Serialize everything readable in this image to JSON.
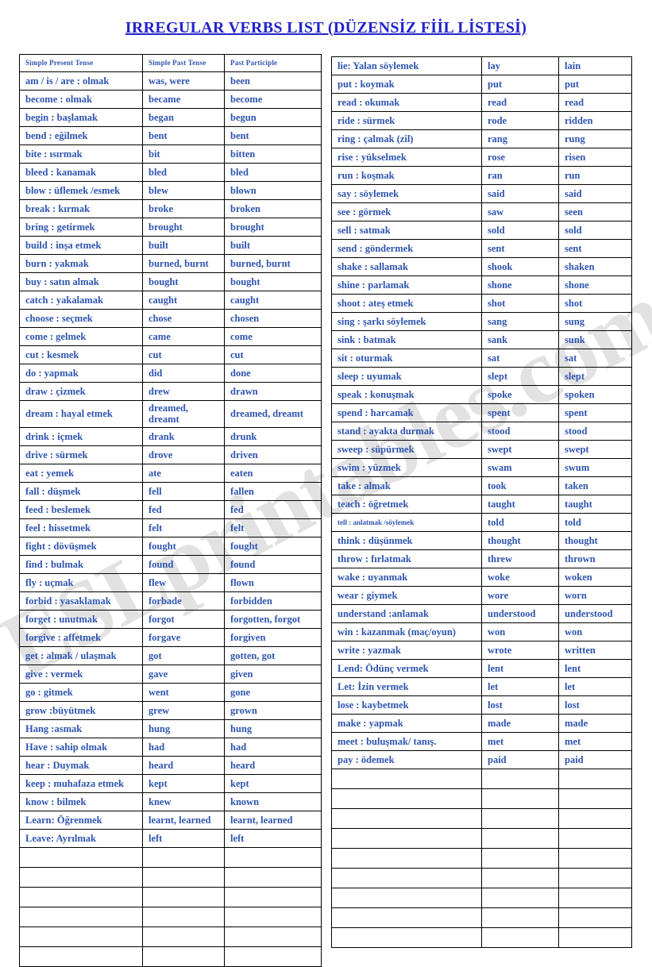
{
  "document": {
    "title": "IRREGULAR VERBS LIST (DÜZENSİZ FİİL LİSTESİ)",
    "title_color": "#2222cc",
    "text_color": "#2f55b0",
    "border_color": "#000000",
    "background": "#ffffff"
  },
  "watermark": {
    "text": "ESLprintables.com"
  },
  "left_table": {
    "headers": [
      "Simple Present Tense",
      "Simple Past Tense",
      "Past Participle"
    ],
    "rows": [
      [
        "am / is / are : olmak",
        "was, were",
        "been"
      ],
      [
        "become : olmak",
        "became",
        "become"
      ],
      [
        "begin : başlamak",
        "began",
        "begun"
      ],
      [
        "bend : eğilmek",
        "bent",
        "bent"
      ],
      [
        "bite : ısırmak",
        "bit",
        "bitten"
      ],
      [
        "bleed : kanamak",
        "bled",
        "bled"
      ],
      [
        "blow : üflemek /esmek",
        "blew",
        "blown"
      ],
      [
        "break : kırmak",
        "broke",
        "broken"
      ],
      [
        "bring : getirmek",
        "brought",
        "brought"
      ],
      [
        "build : inşa etmek",
        "built",
        "built"
      ],
      [
        "burn : yakmak",
        "burned, burnt",
        "burned, burnt"
      ],
      [
        "buy : satın almak",
        "bought",
        "bought"
      ],
      [
        "catch : yakalamak",
        "caught",
        "caught"
      ],
      [
        "choose : seçmek",
        "chose",
        "chosen"
      ],
      [
        "come : gelmek",
        "came",
        "come"
      ],
      [
        "cut : kesmek",
        "cut",
        "cut"
      ],
      [
        "do : yapmak",
        "did",
        "done"
      ],
      [
        "draw : çizmek",
        "drew",
        "drawn"
      ],
      [
        "dream : hayal etmek",
        "dreamed, dreamt",
        "dreamed, dreamt"
      ],
      [
        "drink : içmek",
        "drank",
        "drunk"
      ],
      [
        "drive : sürmek",
        "drove",
        "driven"
      ],
      [
        "eat : yemek",
        "ate",
        "eaten"
      ],
      [
        "fall : düşmek",
        "fell",
        "fallen"
      ],
      [
        "feed : beslemek",
        "fed",
        "fed"
      ],
      [
        "feel : hissetmek",
        "felt",
        "felt"
      ],
      [
        "fight : dövüşmek",
        "fought",
        "fought"
      ],
      [
        "find : bulmak",
        "found",
        "found"
      ],
      [
        "fly : uçmak",
        "flew",
        "flown"
      ],
      [
        "forbid : yasaklamak",
        "forbade",
        "forbidden"
      ],
      [
        "forget : unutmak",
        "forgot",
        "forgotten, forgot"
      ],
      [
        "forgive : affetmek",
        "forgave",
        "forgiven"
      ],
      [
        "get : almak / ulaşmak",
        "got",
        "gotten, got"
      ],
      [
        "give : vermek",
        "gave",
        "given"
      ],
      [
        "go : gitmek",
        "went",
        "gone"
      ],
      [
        "grow :büyütmek",
        "grew",
        "grown"
      ],
      [
        "Hang  :asmak",
        "hung",
        "hung"
      ],
      [
        "Have  : sahip olmak",
        "had",
        "had"
      ],
      [
        "hear : Duymak",
        "heard",
        "heard"
      ],
      [
        "keep :  muhafaza etmek",
        "kept",
        "kept"
      ],
      [
        "know :  bilmek",
        "knew",
        "known"
      ],
      [
        "Learn: Öğrenmek",
        "learnt, learned",
        "learnt, learned"
      ],
      [
        "Leave: Ayrılmak",
        "left",
        "left"
      ]
    ],
    "empty_rows": 6
  },
  "right_table": {
    "rows": [
      [
        "lie: Yalan söylemek",
        "lay",
        "lain"
      ],
      [
        "put : koymak",
        "put",
        "put"
      ],
      [
        "read : okumak",
        "read",
        "read"
      ],
      [
        "ride : sürmek",
        "rode",
        "ridden"
      ],
      [
        "ring : çalmak (zil)",
        "rang",
        "rung"
      ],
      [
        "rise : yükselmek",
        "rose",
        "risen"
      ],
      [
        "run : koşmak",
        "ran",
        "run"
      ],
      [
        "say : söylemek",
        "said",
        "said"
      ],
      [
        "see : görmek",
        "saw",
        "seen"
      ],
      [
        "sell : satmak",
        "sold",
        "sold"
      ],
      [
        "send : göndermek",
        "sent",
        "sent"
      ],
      [
        "shake : sallamak",
        "shook",
        "shaken"
      ],
      [
        "shine : parlamak",
        "shone",
        "shone"
      ],
      [
        "shoot : ateş etmek",
        "shot",
        "shot"
      ],
      [
        "sing : şarkı söylemek",
        "sang",
        "sung"
      ],
      [
        "sink : batmak",
        "sank",
        "sunk"
      ],
      [
        "sit : oturmak",
        "sat",
        "sat"
      ],
      [
        "sleep : uyumak",
        "slept",
        "slept"
      ],
      [
        "speak : konuşmak",
        "spoke",
        "spoken"
      ],
      [
        "spend : harcamak",
        "spent",
        "spent"
      ],
      [
        "stand : ayakta durmak",
        "stood",
        "stood"
      ],
      [
        "sweep : süpürmek",
        "swept",
        "swept"
      ],
      [
        "swim : yüzmek",
        "swam",
        "swum"
      ],
      [
        "take : almak",
        "took",
        "taken"
      ],
      [
        "teach : öğretmek",
        "taught",
        "taught"
      ],
      [
        "tell : anlatmak /söylemek",
        "told",
        "told"
      ],
      [
        "think : düşünmek",
        "thought",
        "thought"
      ],
      [
        "throw : fırlatmak",
        "threw",
        "thrown"
      ],
      [
        "wake : uyanmak",
        "woke",
        "woken"
      ],
      [
        "wear : giymek",
        "wore",
        "worn"
      ],
      [
        "understand :anlamak",
        "understood",
        "understood"
      ],
      [
        "win : kazanmak (maç/oyun)",
        "won",
        "won"
      ],
      [
        "write : yazmak",
        "wrote",
        "written"
      ],
      [
        "Lend: Ödünç vermek",
        "lent",
        "lent"
      ],
      [
        "Let: İzin vermek",
        "let",
        "let"
      ],
      [
        "lose : kaybetmek",
        "lost",
        "lost"
      ],
      [
        "make : yapmak",
        "made",
        "made"
      ],
      [
        "meet : buluşmak/ tanış.",
        "met",
        "met"
      ],
      [
        "pay : ödemek",
        "paid",
        "paid"
      ]
    ],
    "small_font_rows": [
      25
    ],
    "empty_rows": 9
  }
}
